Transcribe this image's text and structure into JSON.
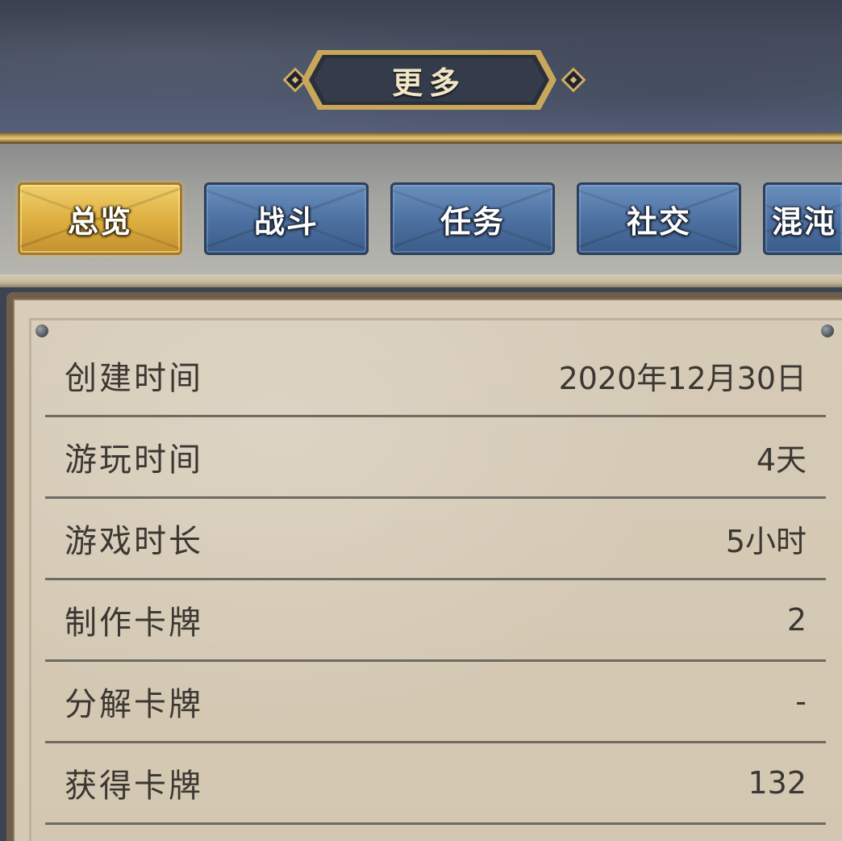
{
  "header": {
    "title": "更多"
  },
  "tabs": [
    {
      "label": "总览",
      "active": true
    },
    {
      "label": "战斗",
      "active": false
    },
    {
      "label": "任务",
      "active": false
    },
    {
      "label": "社交",
      "active": false
    },
    {
      "label": "混沌",
      "active": false
    }
  ],
  "stats": [
    {
      "label": "创建时间",
      "value": "2020年12月30日"
    },
    {
      "label": "游玩时间",
      "value": "4天"
    },
    {
      "label": "游戏时长",
      "value": "5小时"
    },
    {
      "label": "制作卡牌",
      "value": "2"
    },
    {
      "label": "分解卡牌",
      "value": "-"
    },
    {
      "label": "获得卡牌",
      "value": "132"
    }
  ],
  "colors": {
    "header_bg": "#4b5467",
    "gold_accent": "#cfae63",
    "tab_active": "#dcae3e",
    "tab_inactive": "#4b6f9f",
    "panel_bg": "#d6cbb7",
    "text_dark": "#3b3732"
  }
}
